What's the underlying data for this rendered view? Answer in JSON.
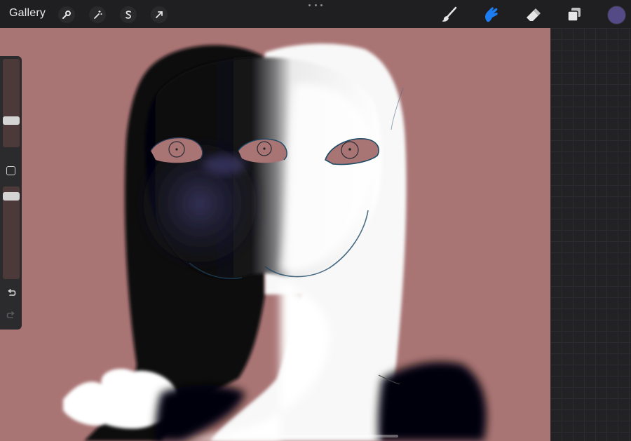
{
  "topbar": {
    "gallery_label": "Gallery",
    "left_tools": [
      {
        "name": "actions",
        "icon": "wrench-icon"
      },
      {
        "name": "adjustments",
        "icon": "magic-wand-icon"
      },
      {
        "name": "selection",
        "icon": "selection-s-icon"
      },
      {
        "name": "transform",
        "icon": "arrow-cursor-icon"
      }
    ],
    "more_icon": "ellipsis-icon",
    "right_tools": [
      {
        "name": "brush",
        "icon": "brush-icon",
        "active": false
      },
      {
        "name": "smudge",
        "icon": "smudge-finger-icon",
        "active": true
      },
      {
        "name": "eraser",
        "icon": "eraser-icon",
        "active": false
      },
      {
        "name": "layers",
        "icon": "layers-icon",
        "active": false
      }
    ],
    "active_tool_color": "#1e7cf2",
    "current_color": "#534a86"
  },
  "sidebar": {
    "brush_size_level": 0.7,
    "opacity_level": 0.95,
    "modify_icon": "square-modify-icon",
    "undo_icon": "undo-icon",
    "redo_icon": "redo-icon"
  },
  "canvas": {
    "background_color": "#a97474",
    "grid_color": "#222225"
  }
}
